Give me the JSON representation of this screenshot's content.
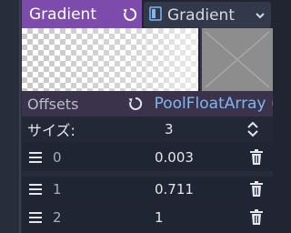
{
  "property": {
    "name": "Gradient"
  },
  "type_selector": {
    "label": "Gradient",
    "icon": "gradient-resource-icon"
  },
  "offsets": {
    "label": "Offsets",
    "value": "PoolFloatArray ("
  },
  "array_size": {
    "label": "サイズ:",
    "value": "3"
  },
  "items": [
    {
      "index": "0",
      "value": "0.003"
    },
    {
      "index": "1",
      "value": "0.711"
    },
    {
      "index": "2",
      "value": "1"
    }
  ],
  "colors": {
    "accent": "#7c4bab",
    "value_link": "#7fb6ee",
    "swatch": "#8d8d8d",
    "background": "#202531"
  }
}
